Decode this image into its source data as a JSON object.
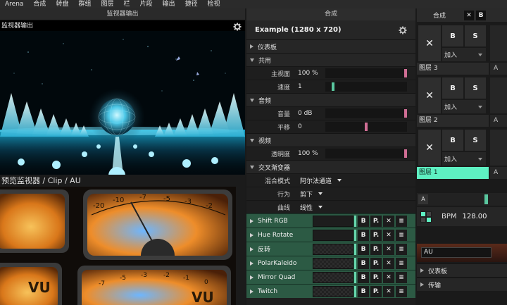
{
  "menu": [
    "Arena",
    "合成",
    "转盘",
    "群组",
    "图层",
    "栏",
    "片段",
    "输出",
    "捷径",
    "检视"
  ],
  "monitor": {
    "title": "监视器输出",
    "output_label": "监视器输出",
    "preview_label": "预览监视器 / Clip / AU"
  },
  "composition": {
    "header": "合成",
    "name": "Example (1280 x 720)",
    "sections": {
      "dashboard": "仪表板",
      "common": "共用",
      "audio": "音频",
      "video": "视频",
      "crossfader": "交叉渐变器"
    },
    "params": {
      "master": {
        "label": "主视面",
        "value": "100 %",
        "level": 1.0
      },
      "speed": {
        "label": "速度",
        "value": "1",
        "level": 0.08
      },
      "volume": {
        "label": "音量",
        "value": "0 dB",
        "level": 1.0
      },
      "pan": {
        "label": "平移",
        "value": "0",
        "level": 0.5
      },
      "opacity": {
        "label": "透明度",
        "value": "100 %",
        "level": 1.0
      }
    },
    "crossfader_params": {
      "mix_mode": {
        "label": "混合模式",
        "value": "阿尔法通道"
      },
      "behavior": {
        "label": "行为",
        "value": "剪下"
      },
      "curve": {
        "label": "曲线",
        "value": "线性"
      }
    },
    "effects": [
      {
        "name": "Shift RGB",
        "b": "B",
        "p": "P.",
        "x": "✕",
        "m": "≡"
      },
      {
        "name": "Hue Rotate",
        "b": "B",
        "p": "P.",
        "x": "✕",
        "m": "≡"
      },
      {
        "name": "反转",
        "b": "B",
        "p": "P.",
        "x": "✕",
        "m": "≡"
      },
      {
        "name": "PolarKaleido",
        "b": "B",
        "p": "P.",
        "x": "✕",
        "m": "≡"
      },
      {
        "name": "Mirror Quad",
        "b": "B",
        "p": "P.",
        "x": "✕",
        "m": "≡"
      },
      {
        "name": "Twitch",
        "b": "B",
        "p": "P.",
        "x": "✕",
        "m": "≡"
      }
    ]
  },
  "layers_panel": {
    "header": "合成",
    "x_label": "✕",
    "b_label": "B",
    "layers": [
      {
        "name": "图层 3",
        "blend": "加入",
        "b": "B",
        "s": "S",
        "clear": "✕",
        "side": "A"
      },
      {
        "name": "图层 2",
        "blend": "加入",
        "b": "B",
        "s": "S",
        "clear": "✕",
        "side": "A"
      },
      {
        "name": "图层 1",
        "blend": "加入",
        "b": "B",
        "s": "S",
        "clear": "✕",
        "side": "A"
      }
    ],
    "crossfader_a": "A",
    "crossfader_level": 0.78,
    "bpm_label": "BPM",
    "bpm_value": "128.00",
    "au_field": "AU",
    "dashboard": "仪表板",
    "transport": "传输"
  },
  "colors": {
    "accent": "#5ef0c2",
    "effect_row": "#2c5a44",
    "thumb_pink": "#d06e95",
    "thumb_green": "#5ac79f"
  }
}
